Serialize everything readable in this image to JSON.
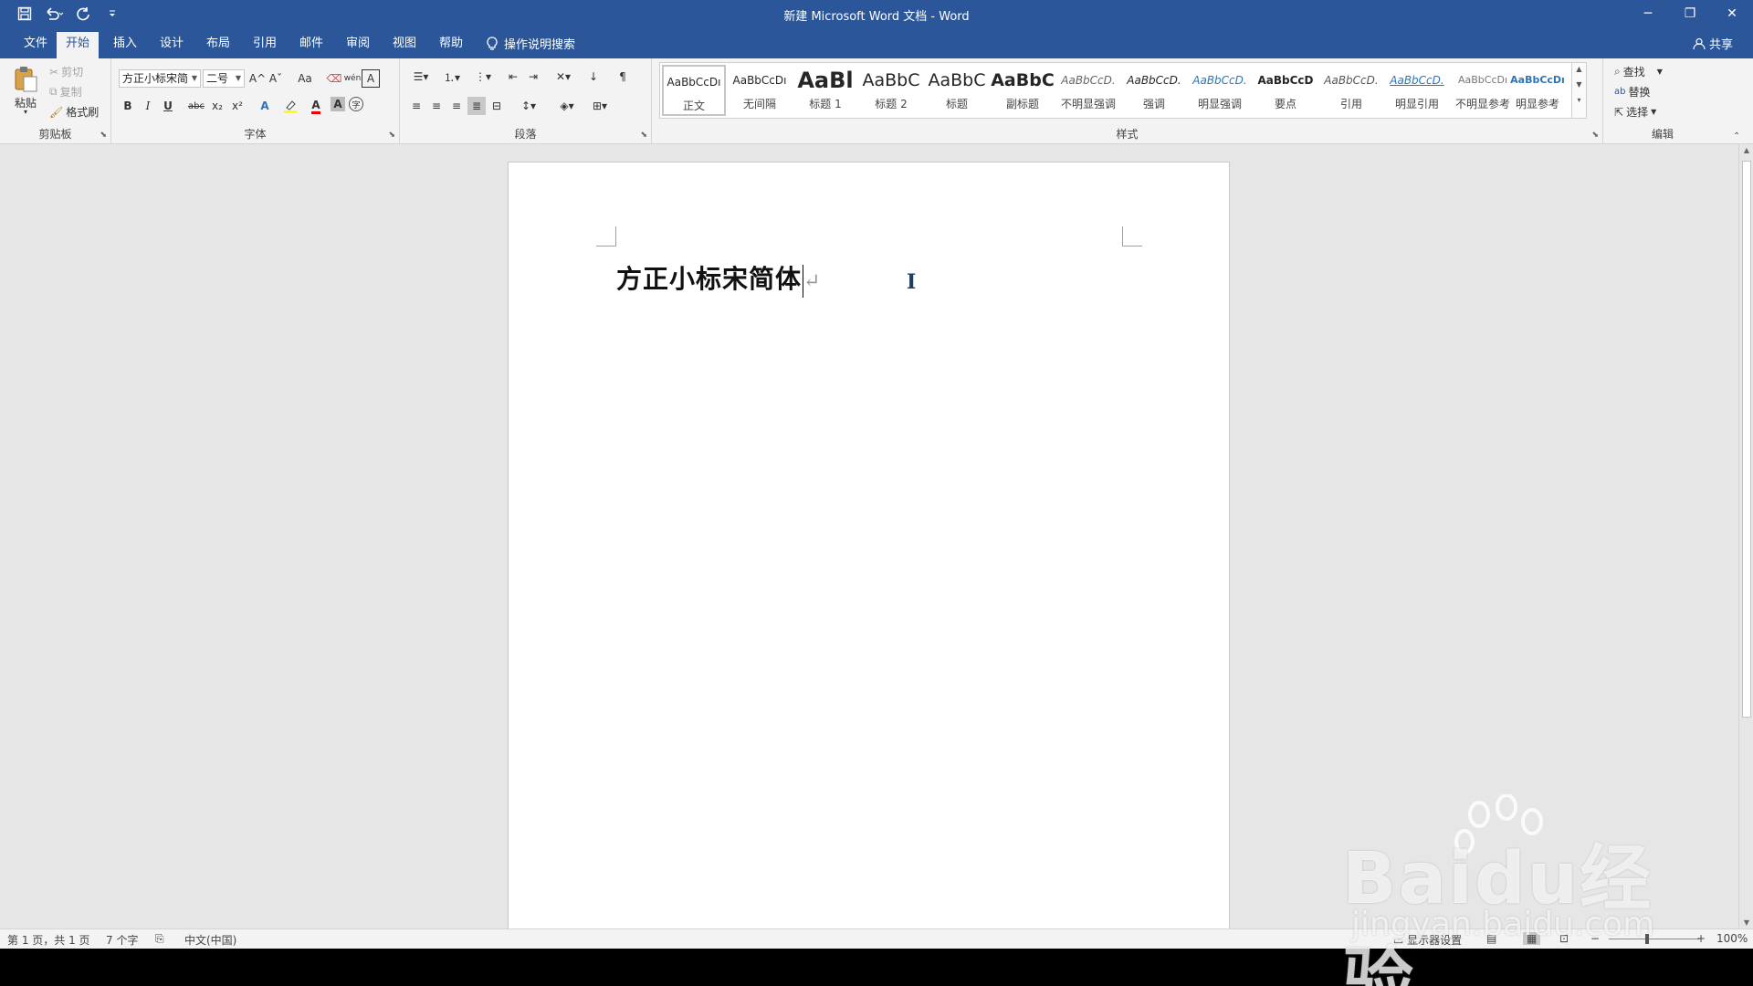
{
  "window": {
    "title": "新建 Microsoft Word 文档  -  Word",
    "controls": {
      "minimize": "─",
      "restore": "❐",
      "close": "✕"
    }
  },
  "tabs": [
    {
      "label": "文件"
    },
    {
      "label": "开始"
    },
    {
      "label": "插入"
    },
    {
      "label": "设计"
    },
    {
      "label": "布局"
    },
    {
      "label": "引用"
    },
    {
      "label": "邮件"
    },
    {
      "label": "审阅"
    },
    {
      "label": "视图"
    },
    {
      "label": "帮助"
    }
  ],
  "search_label": "操作说明搜索",
  "share_label": "共享",
  "clipboard": {
    "paste": "粘贴",
    "cut": "剪切",
    "copy": "复制",
    "format_painter": "格式刷",
    "group": "剪贴板"
  },
  "font": {
    "name": "方正小标宋简",
    "size": "二号",
    "group": "字体",
    "bold": "B",
    "italic": "I",
    "underline": "U",
    "strike": "abc",
    "sub": "x₂",
    "sup": "x²",
    "grow": "A^",
    "shrink": "Aˇ",
    "case": "Aa",
    "phonetic": "wén",
    "border_char": "A",
    "color_a": "A",
    "shade_a": "A",
    "enclose": "字"
  },
  "paragraph": {
    "group": "段落"
  },
  "styles": {
    "group": "样式",
    "items": [
      {
        "preview": "AaBbCcDı",
        "name": "正文"
      },
      {
        "preview": "AaBbCcDı",
        "name": "无间隔"
      },
      {
        "preview": "AaBl",
        "name": "标题 1"
      },
      {
        "preview": "AaBbC",
        "name": "标题 2"
      },
      {
        "preview": "AaBbC",
        "name": "标题"
      },
      {
        "preview": "AaBbC",
        "name": "副标题"
      },
      {
        "preview": "AaBbCcD.",
        "name": "不明显强调"
      },
      {
        "preview": "AaBbCcD.",
        "name": "强调"
      },
      {
        "preview": "AaBbCcD.",
        "name": "明显强调"
      },
      {
        "preview": "AaBbCcD",
        "name": "要点"
      },
      {
        "preview": "AaBbCcD.",
        "name": "引用"
      },
      {
        "preview": "AaBbCcD.",
        "name": "明显引用"
      },
      {
        "preview": "AaBbCcDı",
        "name": "不明显参考"
      },
      {
        "preview": "AaBbCcDı",
        "name": "明显参考"
      }
    ]
  },
  "editing": {
    "find": "查找",
    "replace": "替换",
    "select": "选择",
    "group": "编辑"
  },
  "document": {
    "text": "方正小标宋简体",
    "para_mark": "↵"
  },
  "status": {
    "page": "第 1 页，共 1 页",
    "words": "7 个字",
    "language": "中文(中国)",
    "display": "显示器设置",
    "zoom": "100%"
  },
  "watermark": {
    "brand": "Baidu经验",
    "url": "jingyan.baidu.com"
  },
  "colors": {
    "accent": "#2b579a",
    "ribbon": "#f3f3f3",
    "canvas": "#e6e6e6"
  }
}
